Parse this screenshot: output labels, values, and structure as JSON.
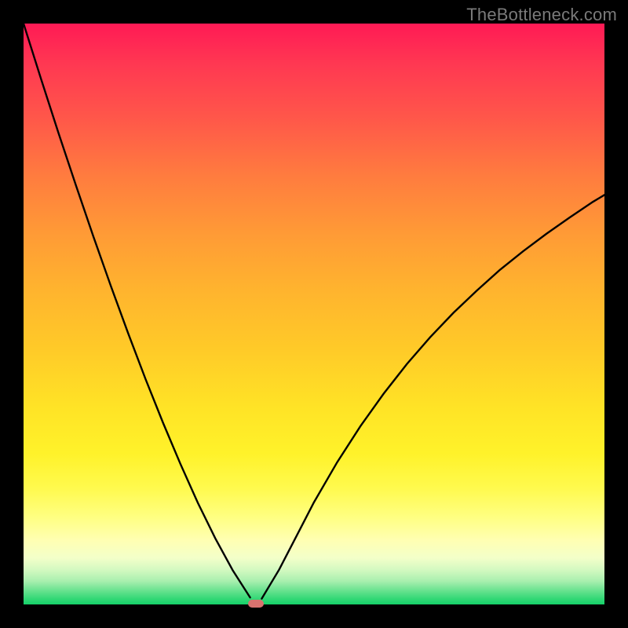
{
  "watermark": "TheBottleneck.com",
  "colors": {
    "frame": "#000000",
    "curve": "#000000",
    "marker": "#d9726f"
  },
  "chart_data": {
    "type": "line",
    "title": "",
    "xlabel": "",
    "ylabel": "",
    "xlim": [
      0,
      1
    ],
    "ylim": [
      0,
      1
    ],
    "grid": false,
    "legend": false,
    "note": "V-shaped bottleneck curve on red→yellow→green vertical gradient background. Axis ticks are not labeled; x and y are normalized 0–1. y represents bottleneck severity (1=top/red=worst, 0=bottom/green=best). Minimum of both branches occurs near x≈0.40 where y≈0.",
    "series": [
      {
        "name": "left-branch",
        "x": [
          0.0,
          0.03,
          0.06,
          0.09,
          0.12,
          0.15,
          0.18,
          0.21,
          0.24,
          0.27,
          0.3,
          0.33,
          0.36,
          0.39
        ],
        "values": [
          1.0,
          0.905,
          0.812,
          0.722,
          0.634,
          0.549,
          0.467,
          0.388,
          0.313,
          0.242,
          0.175,
          0.114,
          0.059,
          0.012
        ]
      },
      {
        "name": "right-branch",
        "x": [
          0.41,
          0.44,
          0.47,
          0.5,
          0.54,
          0.58,
          0.62,
          0.66,
          0.7,
          0.74,
          0.78,
          0.82,
          0.86,
          0.9,
          0.94,
          0.98,
          1.0
        ],
        "values": [
          0.01,
          0.06,
          0.118,
          0.176,
          0.245,
          0.307,
          0.363,
          0.414,
          0.46,
          0.502,
          0.54,
          0.576,
          0.608,
          0.638,
          0.666,
          0.693,
          0.705
        ]
      }
    ],
    "marker": {
      "x": 0.4,
      "y": 0.0
    }
  }
}
